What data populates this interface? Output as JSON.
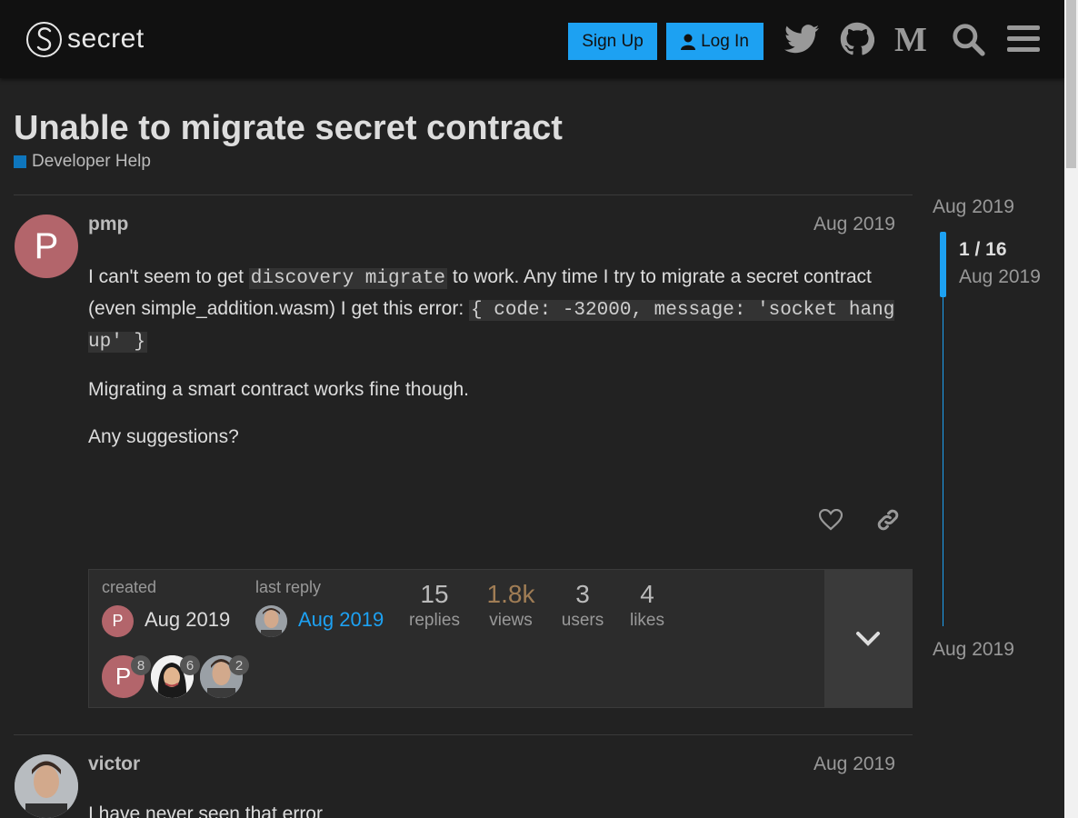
{
  "header": {
    "logo_text": "secret",
    "signup_label": "Sign Up",
    "login_label": "Log In",
    "icons": [
      "twitter-icon",
      "github-icon",
      "medium-icon",
      "search-icon",
      "hamburger-menu-icon"
    ],
    "accent_color": "#1da1f2"
  },
  "topic": {
    "title": "Unable to migrate secret contract",
    "category": "Developer Help",
    "category_color": "#0e76bd"
  },
  "post1": {
    "avatar_letter": "P",
    "username": "pmp",
    "date": "Aug 2019",
    "p1_a": "I can't seem to get ",
    "p1_code1": "discovery migrate",
    "p1_b": " to work. Any time I try to migrate a secret contract (even simple_addition.wasm) I get this error: ",
    "p1_code2": "{ code: -32000, message: 'socket hang up' }",
    "p2": "Migrating a smart contract works fine though.",
    "p3": "Any suggestions?"
  },
  "topic_map": {
    "created_label": "created",
    "created_date": "Aug 2019",
    "last_reply_label": "last reply",
    "last_reply_date": "Aug 2019",
    "stats": [
      {
        "value": "15",
        "label": "replies"
      },
      {
        "value": "1.8k",
        "label": "views"
      },
      {
        "value": "3",
        "label": "users"
      },
      {
        "value": "4",
        "label": "likes"
      }
    ],
    "participants": [
      {
        "count": "8"
      },
      {
        "count": "6"
      },
      {
        "count": "2"
      }
    ],
    "participant_letter": "P"
  },
  "timeline": {
    "top_date": "Aug 2019",
    "count": "1 / 16",
    "current_date": "Aug 2019",
    "bottom_date": "Aug 2019"
  },
  "post2": {
    "username": "victor",
    "date": "Aug 2019",
    "text": "I have never seen that error"
  }
}
